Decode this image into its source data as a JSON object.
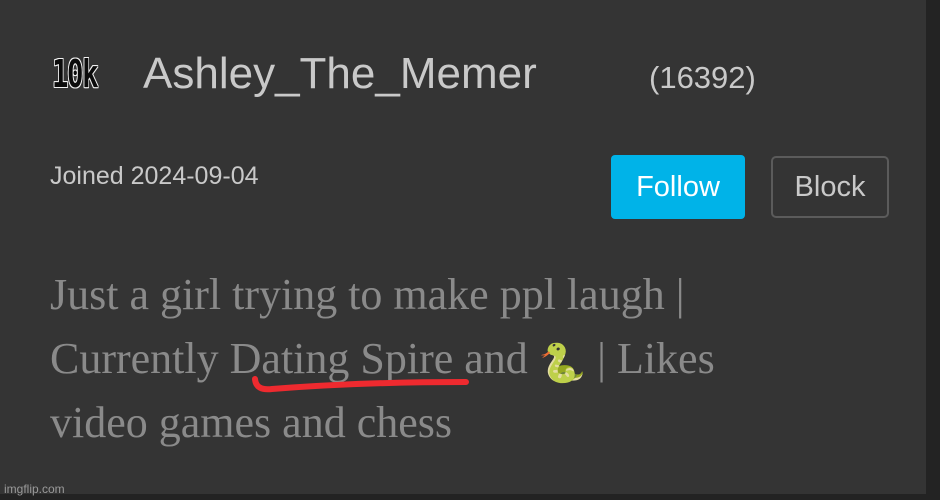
{
  "profile": {
    "badge": "10k",
    "username": "Ashley_The_Memer",
    "points": "(16392)",
    "joined": "Joined 2024-09-04"
  },
  "actions": {
    "follow_label": "Follow",
    "block_label": "Block"
  },
  "bio": {
    "line1": "Just a girl trying to make ppl laugh |",
    "line2_before": "Currently ",
    "line2_highlight": "Dating Spire",
    "line2_mid": " and ",
    "line2_emoji": "🐍",
    "line2_after": " | Likes",
    "line3": "video games and chess"
  },
  "watermark": "imgflip.com",
  "colors": {
    "background": "#343434",
    "text_primary": "#c9c9c9",
    "bio_text": "#8a8a8a",
    "follow_button": "#00b3e8",
    "annotation_red": "#ee2a2f"
  },
  "icons": {
    "bio_emoji": "snake-icon"
  }
}
